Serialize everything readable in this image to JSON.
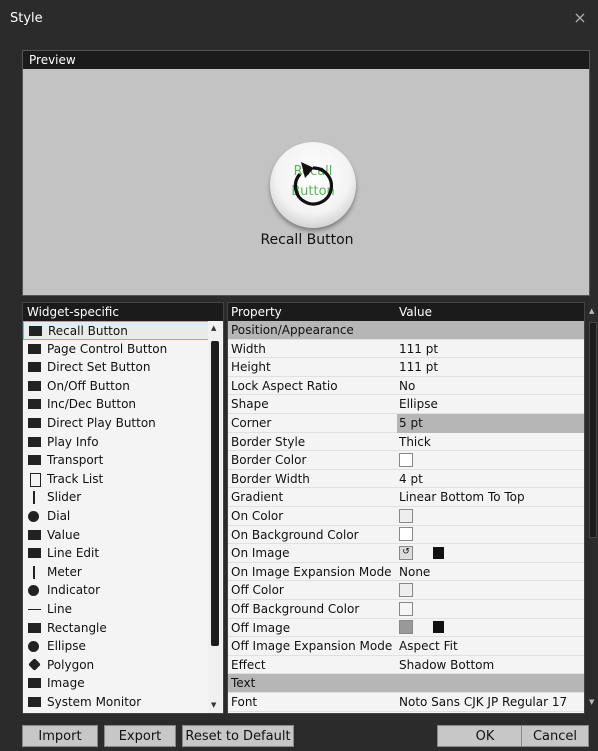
{
  "window": {
    "title": "Style",
    "close_glyph": "×"
  },
  "preview": {
    "header": "Preview",
    "widget_text": "Recall Button",
    "widget_label": "Recall Button",
    "widget_text_color": "#5db35d"
  },
  "widget_list": {
    "header": "Widget-specific",
    "items": [
      {
        "label": "Recall Button",
        "icon": "button-icon",
        "selected": true
      },
      {
        "label": "Page Control Button",
        "icon": "button-icon"
      },
      {
        "label": "Direct Set Button",
        "icon": "button-icon"
      },
      {
        "label": "On/Off Button",
        "icon": "button-icon"
      },
      {
        "label": "Inc/Dec Button",
        "icon": "button-icon"
      },
      {
        "label": "Direct Play Button",
        "icon": "button-icon"
      },
      {
        "label": "Play Info",
        "icon": "play-info-icon"
      },
      {
        "label": "Transport",
        "icon": "transport-icon"
      },
      {
        "label": "Track List",
        "icon": "track-list-icon"
      },
      {
        "label": "Slider",
        "icon": "slider-icon"
      },
      {
        "label": "Dial",
        "icon": "dial-icon"
      },
      {
        "label": "Value",
        "icon": "value-icon"
      },
      {
        "label": "Line Edit",
        "icon": "line-edit-icon"
      },
      {
        "label": "Meter",
        "icon": "meter-icon"
      },
      {
        "label": "Indicator",
        "icon": "indicator-icon"
      },
      {
        "label": "Line",
        "icon": "line-icon"
      },
      {
        "label": "Rectangle",
        "icon": "rectangle-icon"
      },
      {
        "label": "Ellipse",
        "icon": "ellipse-icon"
      },
      {
        "label": "Polygon",
        "icon": "polygon-icon"
      },
      {
        "label": "Image",
        "icon": "image-icon"
      },
      {
        "label": "System Monitor",
        "icon": "system-monitor-icon"
      }
    ]
  },
  "properties": {
    "header_property": "Property",
    "header_value": "Value",
    "rows": [
      {
        "type": "section",
        "name": "Position/Appearance"
      },
      {
        "name": "Width",
        "value": "111 pt"
      },
      {
        "name": "Height",
        "value": "111 pt"
      },
      {
        "name": "Lock Aspect Ratio",
        "value": "No"
      },
      {
        "name": "Shape",
        "value": "Ellipse"
      },
      {
        "name": "Corner",
        "value": "5 pt",
        "highlight": true
      },
      {
        "name": "Border Style",
        "value": "Thick"
      },
      {
        "name": "Border Color",
        "value": "",
        "swatch": "#ffffff"
      },
      {
        "name": "Border Width",
        "value": "4 pt"
      },
      {
        "name": "Gradient",
        "value": "Linear Bottom To Top"
      },
      {
        "name": "On Color",
        "value": "",
        "swatch": "#eeeeee"
      },
      {
        "name": "On Background Color",
        "value": "",
        "swatch": "#ffffff"
      },
      {
        "name": "On Image",
        "value": "",
        "image_icon": "recall-icon",
        "trash": true
      },
      {
        "name": "On Image Expansion Mode",
        "value": "None"
      },
      {
        "name": "Off Color",
        "value": "",
        "swatch": "#eeeeee"
      },
      {
        "name": "Off Background Color",
        "value": "",
        "swatch": "#f5f5f5"
      },
      {
        "name": "Off Image",
        "value": "",
        "swatch": "#999999",
        "trash": true
      },
      {
        "name": "Off Image Expansion Mode",
        "value": "Aspect Fit"
      },
      {
        "name": "Effect",
        "value": "Shadow Bottom"
      },
      {
        "type": "section",
        "name": "Text"
      },
      {
        "name": "Font",
        "value": "Noto Sans CJK JP Regular 17"
      }
    ]
  },
  "buttons": {
    "import": "Import",
    "export": "Export",
    "reset": "Reset to Default",
    "ok": "OK",
    "cancel": "Cancel"
  }
}
